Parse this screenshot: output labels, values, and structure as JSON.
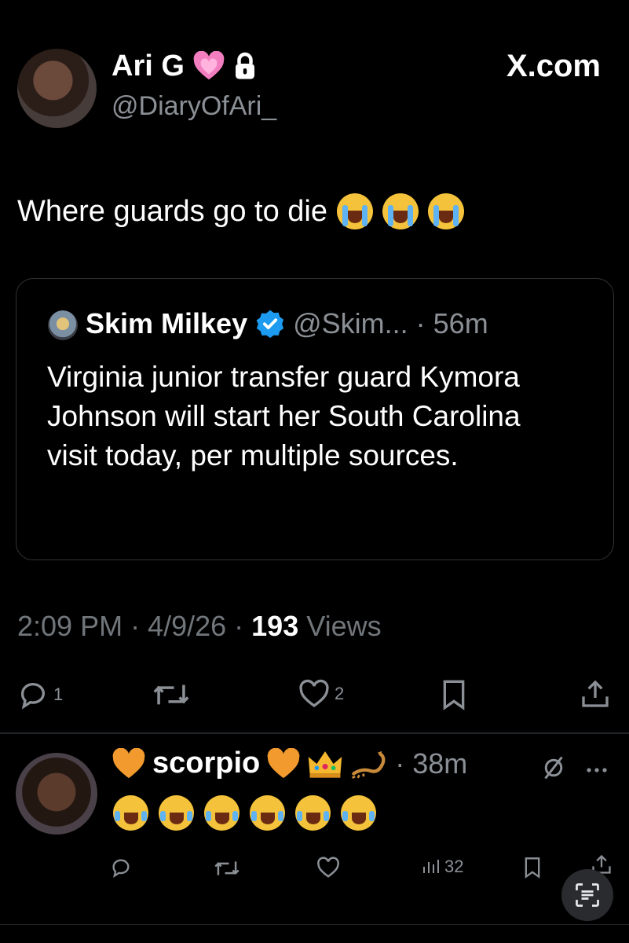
{
  "site": "X.com",
  "post": {
    "display_name": "Ari G",
    "handle": "@DiaryOfAri_",
    "text": "Where guards go to die",
    "name_heart_icon": "pink-heart",
    "lock_icon": "lock",
    "emoji_count": 3,
    "timestamp": "2:09 PM · 4/9/26 · ",
    "views_count": "193",
    "views_label": " Views",
    "reply_count": "1",
    "like_count": "2"
  },
  "quote": {
    "display_name": "Skim Milkey",
    "handle_time": "@Skim... · 56m",
    "text": "Virginia junior transfer guard Kymora Johnson will start her South Carolina visit today, per multiple sources."
  },
  "reply": {
    "display_name": "scorpio",
    "time": "· 38m",
    "emoji_count": 6,
    "views_count": "32"
  },
  "colors": {
    "background": "#000000",
    "text": "#e7e9ea",
    "muted": "#71767b",
    "verified": "#1d9bf0",
    "pink_heart": "#f27ec0",
    "orange_heart": "#f29a2e"
  }
}
